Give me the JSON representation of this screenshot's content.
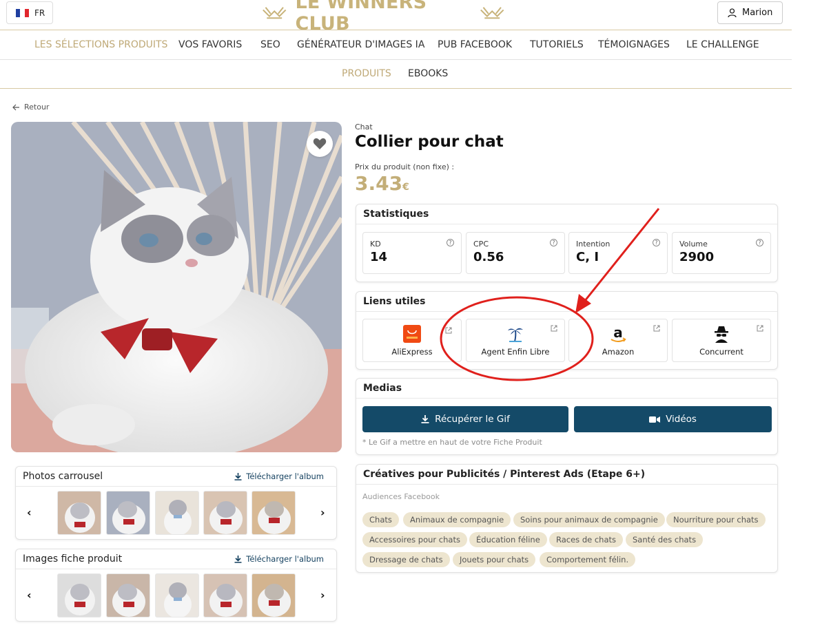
{
  "header": {
    "lang": "FR",
    "brand": "LE WINNERS CLUB",
    "user": "Marion"
  },
  "nav": {
    "main": [
      "LES SÉLECTIONS PRODUITS",
      "VOS FAVORIS",
      "SEO",
      "GÉNÉRATEUR D'IMAGES IA",
      "PUB FACEBOOK",
      "TUTORIELS",
      "TÉMOIGNAGES",
      "LE CHALLENGE"
    ],
    "sub": [
      "PRODUITS",
      "EBOOKS"
    ]
  },
  "back_label": "Retour",
  "product": {
    "category": "Chat",
    "title": "Collier pour chat",
    "price_label": "Prix du produit (non fixe) :",
    "price": "3.43",
    "currency": "€"
  },
  "stats": {
    "title": "Statistiques",
    "items": [
      {
        "label": "KD",
        "value": "14"
      },
      {
        "label": "CPC",
        "value": "0.56"
      },
      {
        "label": "Intention",
        "value": "C, I"
      },
      {
        "label": "Volume",
        "value": "2900"
      }
    ]
  },
  "links": {
    "title": "Liens utiles",
    "items": [
      {
        "name": "AliExpress",
        "icon": "aliexpress-icon"
      },
      {
        "name": "Agent Enfin Libre",
        "icon": "palm-tree-icon"
      },
      {
        "name": "Amazon",
        "icon": "amazon-icon"
      },
      {
        "name": "Concurrent",
        "icon": "spy-icon"
      }
    ]
  },
  "medias": {
    "title": "Medias",
    "gif_button": "Récupérer le Gif",
    "video_button": "Vidéos",
    "note": "* Le Gif a mettre en haut de votre Fiche Produit"
  },
  "creatives": {
    "title": "Créatives pour Publicités / Pinterest Ads (Etape 6+)",
    "audience_label": "Audiences Facebook",
    "tags": [
      "Chats",
      "Animaux de compagnie",
      "Soins pour animaux de compagnie",
      "Nourriture pour chats",
      "Accessoires pour chats",
      "Éducation féline",
      "Races de chats",
      "Santé des chats",
      "Dressage de chats",
      "Jouets pour chats",
      "Comportement félin."
    ]
  },
  "carousels": [
    {
      "title": "Photos carrousel",
      "download": "Télécharger l'album"
    },
    {
      "title": "Images fiche produit",
      "download": "Télécharger l'album"
    }
  ],
  "colors": {
    "gold": "#c3ae78",
    "navy": "#144a68",
    "annotation": "#e0201c"
  }
}
